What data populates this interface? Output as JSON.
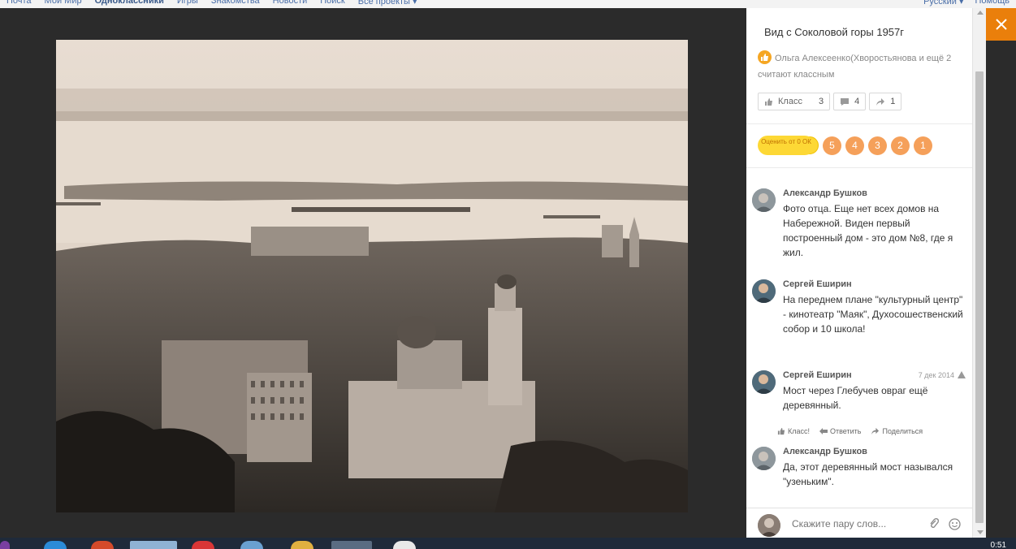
{
  "topnav": {
    "items": [
      "Почта",
      "Мой Мир",
      "Одноклассники",
      "Игры",
      "Знакомства",
      "Новости",
      "Поиск",
      "Все проекты ▾"
    ],
    "lang": "Русский ▾",
    "help": "Помощь"
  },
  "photo": {
    "title": "Вид с Соколовой горы 1957г"
  },
  "likes": {
    "text": "Ольга Алексеенко(Хворостьянова и ещё 2 считают классным"
  },
  "actions": {
    "klass_label": "Класс",
    "klass_count": "3",
    "comments_count": "4",
    "shares_count": "1"
  },
  "rating": {
    "label": "Оценить от 0 ОК",
    "plus": "5+",
    "values": [
      "5",
      "4",
      "3",
      "2",
      "1"
    ]
  },
  "comments": [
    {
      "author": "Александр Бушков",
      "date": "",
      "text": "Фото отца. Еще нет всех домов на Набережной. Виден первый построенный дом - это дом №8, где я жил."
    },
    {
      "author": "Сергей Еширин",
      "date": "",
      "text": "На переднем плане \"культурный центр\" - кинотеатр \"Маяк\", Духосошественский собор и 10 школа!"
    },
    {
      "author": "Сергей Еширин",
      "date": "7 дек 2014",
      "text": "Мост через Глебучев овраг ещё деревянный."
    },
    {
      "author": "Александр Бушков",
      "date": "",
      "text": "Да, этот деревянный мост назывался \"узеньким\"."
    }
  ],
  "comment_actions": {
    "klass": "Класс!",
    "reply": "Ответить",
    "share": "Поделиться"
  },
  "input": {
    "placeholder": "Скажите пару слов..."
  },
  "taskbar": {
    "clock": "0:51"
  },
  "colors": {
    "accent": "#ea7f0b",
    "rating_orange": "#f5a05a",
    "rating_yellow": "#fdd835"
  }
}
